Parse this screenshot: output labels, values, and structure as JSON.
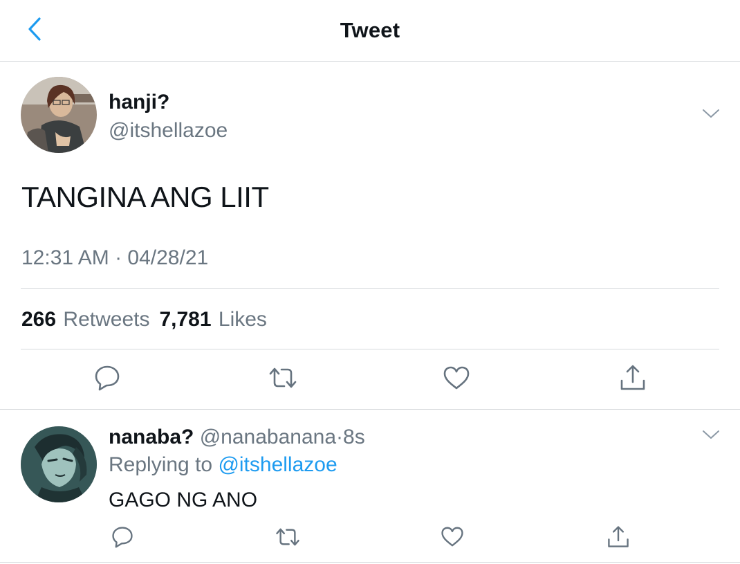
{
  "header": {
    "title": "Tweet",
    "back_icon": "chevron-left-icon"
  },
  "colors": {
    "accent": "#1d9bf0",
    "secondary_text": "#6a7681",
    "divider": "#d6d9dc",
    "primary_text": "#0f1419"
  },
  "tweet": {
    "author_name": "hanji?",
    "author_handle": "@itshellazoe",
    "text": "TANGINA ANG LIIT",
    "timestamp": "12:31 AM · 04/28/21",
    "retweets_count": "266",
    "retweets_label": "Retweets",
    "likes_count": "7,781",
    "likes_label": "Likes",
    "actions": [
      "reply-icon",
      "retweet-icon",
      "like-icon",
      "share-icon"
    ]
  },
  "reply": {
    "author_name": "nanaba?",
    "author_handle": "@nanabanana",
    "separator": "·",
    "time": "8s",
    "replying_to_prefix": "Replying to ",
    "replying_to_handle": "@itshellazoe",
    "text": "GAGO NG ANO",
    "actions": [
      "reply-icon",
      "retweet-icon",
      "like-icon",
      "share-icon"
    ]
  }
}
